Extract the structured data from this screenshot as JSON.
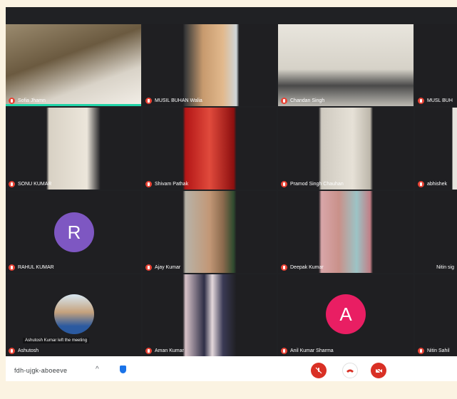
{
  "participants": [
    {
      "name": "Sofia Jhamn",
      "avatar_letter": "",
      "speaking": true
    },
    {
      "name": "MUSIL BUHAN Walia",
      "avatar_letter": "",
      "speaking": false
    },
    {
      "name": "Chandan Singh",
      "avatar_letter": "",
      "speaking": false
    },
    {
      "name": "MUSL BUH",
      "avatar_letter": "",
      "speaking": false
    },
    {
      "name": "SONU KUMAR",
      "avatar_letter": "",
      "speaking": false
    },
    {
      "name": "Shivam Pathak",
      "avatar_letter": "",
      "speaking": false
    },
    {
      "name": "Pramod Singh Chauhan",
      "avatar_letter": "",
      "speaking": false
    },
    {
      "name": "abhishek",
      "avatar_letter": "",
      "speaking": false
    },
    {
      "name": "RAHUL KUMAR",
      "avatar_letter": "R",
      "speaking": false
    },
    {
      "name": "Ajay Kumar",
      "avatar_letter": "",
      "speaking": false
    },
    {
      "name": "Deepak Kumar",
      "avatar_letter": "",
      "speaking": false
    },
    {
      "name": "Nitin sig",
      "avatar_letter": "",
      "speaking": false
    },
    {
      "name": "Ashutosh",
      "avatar_letter": "",
      "speaking": false
    },
    {
      "name": "Aman Kumar",
      "avatar_letter": "",
      "speaking": false
    },
    {
      "name": "Anil Kumar Sharma",
      "avatar_letter": "A",
      "speaking": false
    },
    {
      "name": "Nitin Sahil",
      "avatar_letter": "",
      "speaking": false
    }
  ],
  "caption": "Ashutosh Kumar left the meeting",
  "bottom_bar": {
    "meeting_code": "fdh-ujgk-aboeeve",
    "chevron": "^"
  },
  "colors": {
    "grid_bg": "#202124",
    "hangup": "#d93025",
    "speaking": "#21d4a8",
    "avatar_r": "#7e57c2",
    "avatar_a": "#e91e63"
  }
}
